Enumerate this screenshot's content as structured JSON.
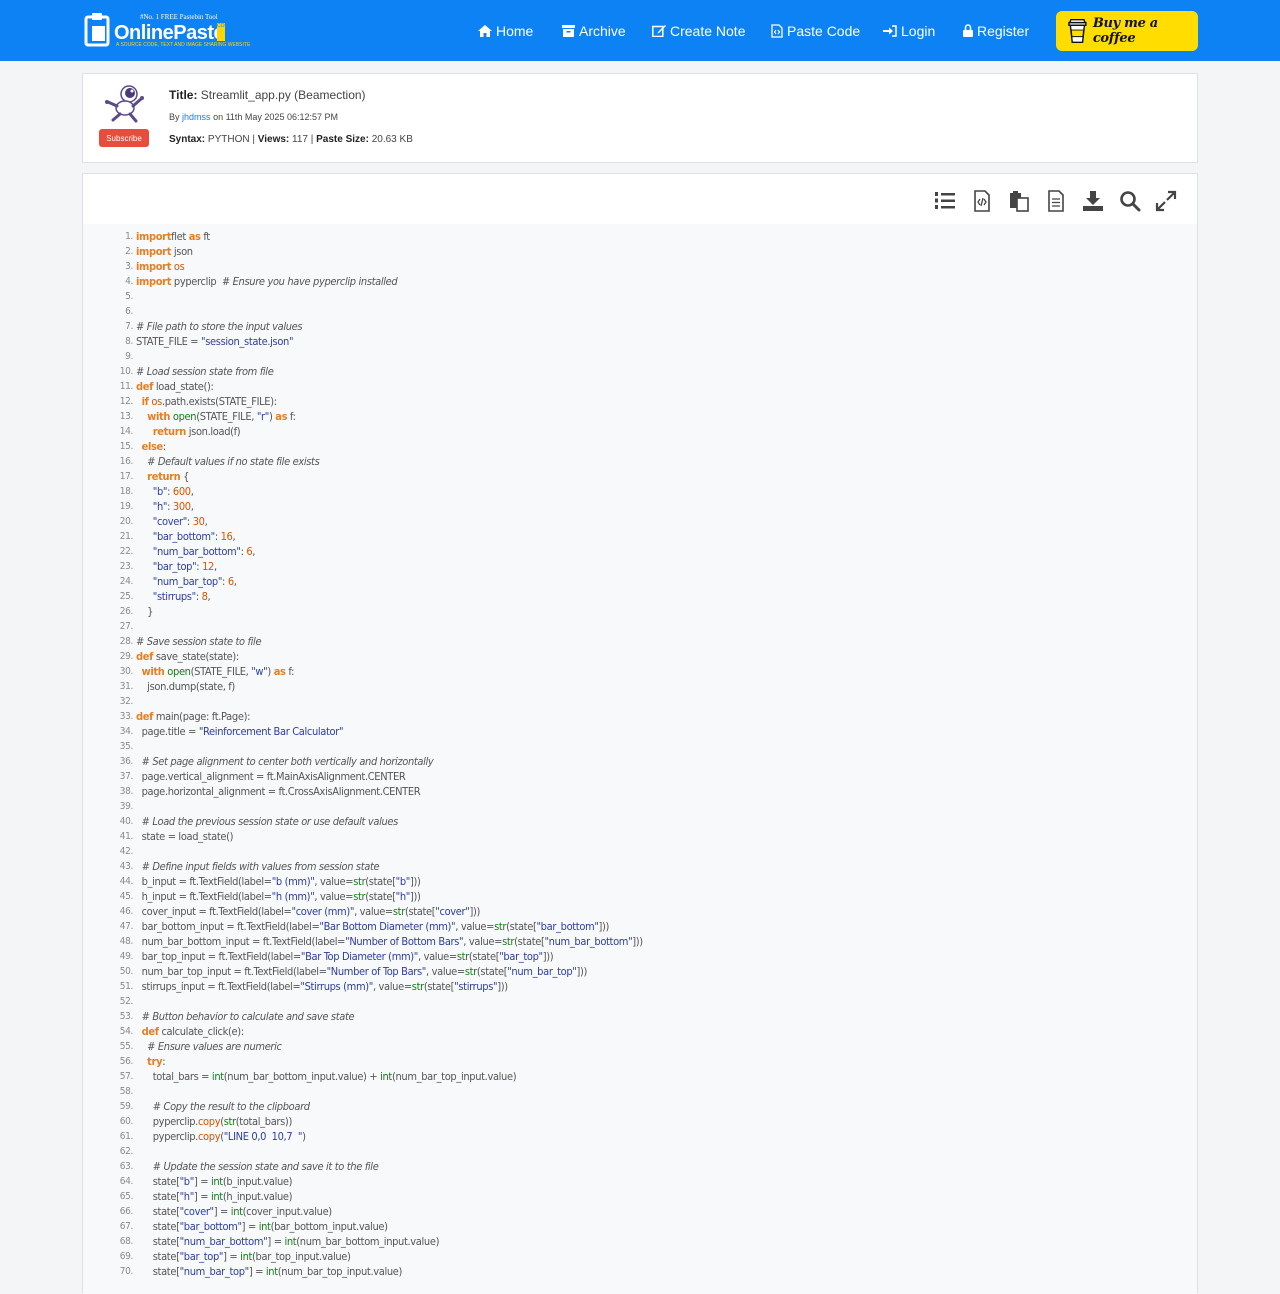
{
  "brand": {
    "tagline": "#No. 1 FREE Pastebin Tool",
    "name": "OnlinePaste",
    "com": "COM",
    "subtitle": "A SOURCE CODE, TEXT AND IMAGE SHARING WEBSITE"
  },
  "nav": {
    "home": "Home",
    "archive": "Archive",
    "create_note": "Create Note",
    "paste_code": "Paste Code",
    "login": "Login",
    "register": "Register",
    "coffee": "Buy me a coffee"
  },
  "colors": {
    "navbar": "#0d82f5",
    "coffee": "#ffdd00",
    "subscribe": "#e74c3c",
    "keyword": "#e67e22",
    "string": "#2c3e9e"
  },
  "paste": {
    "subscribe": "Subscribe",
    "title_label": "Title:",
    "title": "Streamlit_app.py (Beamection)",
    "by_label": "By",
    "author": "jhdmss",
    "date": "on 11th May 2025 06:12:57 PM",
    "syntax_label": "Syntax:",
    "syntax": "PYTHON",
    "views_label": "Views:",
    "views": "117",
    "size_label": "Paste Size:",
    "size": "20.63 KB"
  },
  "toolbar": [
    "line-numbers-icon",
    "view-source-icon",
    "copy-icon",
    "raw-icon",
    "download-icon",
    "search-icon",
    "fullscreen-icon"
  ],
  "code": [
    [
      [
        "kw",
        "import"
      ],
      [
        "",
        "flet "
      ],
      [
        "kw",
        "as"
      ],
      [
        "",
        " ft"
      ]
    ],
    [
      [
        "kw",
        "import"
      ],
      [
        "",
        " json"
      ]
    ],
    [
      [
        "kw",
        "import"
      ],
      [
        "nu",
        " os"
      ]
    ],
    [
      [
        "kw",
        "import"
      ],
      [
        "",
        " pyperclip  "
      ],
      [
        "cm",
        "# Ensure you have pyperclip installed"
      ]
    ],
    [],
    [],
    [
      [
        "cm",
        "# File path to store the input values"
      ]
    ],
    [
      [
        "",
        "STATE_FILE = "
      ],
      [
        "st",
        "\"session_state.json\""
      ]
    ],
    [],
    [
      [
        "cm",
        "# Load session state from file"
      ]
    ],
    [
      [
        "kw",
        "def"
      ],
      [
        "",
        " load_state():"
      ]
    ],
    [
      [
        "",
        "  "
      ],
      [
        "kw",
        "if"
      ],
      [
        "nu",
        " os"
      ],
      [
        "",
        ".path.exists(STATE_FILE):"
      ]
    ],
    [
      [
        "",
        "    "
      ],
      [
        "kw",
        "with"
      ],
      [
        "bi",
        " open"
      ],
      [
        "",
        "(STATE_FILE, "
      ],
      [
        "st",
        "\"r\""
      ],
      [
        "",
        ") "
      ],
      [
        "kw",
        "as"
      ],
      [
        "",
        " f:"
      ]
    ],
    [
      [
        "",
        "      "
      ],
      [
        "kw",
        "return"
      ],
      [
        "",
        " json.load(f)"
      ]
    ],
    [
      [
        "",
        "  "
      ],
      [
        "kw",
        "else"
      ],
      [
        "",
        ":"
      ]
    ],
    [
      [
        "",
        "    "
      ],
      [
        "cm",
        "# Default values if no state file exists"
      ]
    ],
    [
      [
        "",
        "    "
      ],
      [
        "kw",
        "return"
      ],
      [
        "",
        " {"
      ]
    ],
    [
      [
        "",
        "      "
      ],
      [
        "st",
        "\"b\""
      ],
      [
        "",
        ": "
      ],
      [
        "nu",
        "600"
      ],
      [
        "",
        ","
      ]
    ],
    [
      [
        "",
        "      "
      ],
      [
        "st",
        "\"h\""
      ],
      [
        "",
        ": "
      ],
      [
        "nu",
        "300"
      ],
      [
        "",
        ","
      ]
    ],
    [
      [
        "",
        "      "
      ],
      [
        "st",
        "\"cover\""
      ],
      [
        "",
        ": "
      ],
      [
        "nu",
        "30"
      ],
      [
        "",
        ","
      ]
    ],
    [
      [
        "",
        "      "
      ],
      [
        "st",
        "\"bar_bottom\""
      ],
      [
        "",
        ": "
      ],
      [
        "nu",
        "16"
      ],
      [
        "",
        ","
      ]
    ],
    [
      [
        "",
        "      "
      ],
      [
        "st",
        "\"num_bar_bottom\""
      ],
      [
        "",
        ": "
      ],
      [
        "nu",
        "6"
      ],
      [
        "",
        ","
      ]
    ],
    [
      [
        "",
        "      "
      ],
      [
        "st",
        "\"bar_top\""
      ],
      [
        "",
        ": "
      ],
      [
        "nu",
        "12"
      ],
      [
        "",
        ","
      ]
    ],
    [
      [
        "",
        "      "
      ],
      [
        "st",
        "\"num_bar_top\""
      ],
      [
        "",
        ": "
      ],
      [
        "nu",
        "6"
      ],
      [
        "",
        ","
      ]
    ],
    [
      [
        "",
        "      "
      ],
      [
        "st",
        "\"stirrups\""
      ],
      [
        "",
        ": "
      ],
      [
        "nu",
        "8"
      ],
      [
        "",
        ","
      ]
    ],
    [
      [
        "",
        "    }"
      ]
    ],
    [],
    [
      [
        "cm",
        "# Save session state to file"
      ]
    ],
    [
      [
        "kw",
        "def"
      ],
      [
        "",
        " save_state(state):"
      ]
    ],
    [
      [
        "",
        "  "
      ],
      [
        "kw",
        "with"
      ],
      [
        "bi",
        " open"
      ],
      [
        "",
        "(STATE_FILE, "
      ],
      [
        "st",
        "\"w\""
      ],
      [
        "",
        ") "
      ],
      [
        "kw",
        "as"
      ],
      [
        "",
        " f:"
      ]
    ],
    [
      [
        "",
        "    json.dump(state, f)"
      ]
    ],
    [],
    [
      [
        "kw",
        "def"
      ],
      [
        "",
        " main(page: ft.Page):"
      ]
    ],
    [
      [
        "",
        "  page.title = "
      ],
      [
        "st",
        "\"Reinforcement Bar Calculator\""
      ]
    ],
    [],
    [
      [
        "",
        "  "
      ],
      [
        "cm",
        "# Set page alignment to center both vertically and horizontally"
      ]
    ],
    [
      [
        "",
        "  page.vertical_alignment = ft.MainAxisAlignment.CENTER"
      ]
    ],
    [
      [
        "",
        "  page.horizontal_alignment = ft.CrossAxisAlignment.CENTER"
      ]
    ],
    [],
    [
      [
        "",
        "  "
      ],
      [
        "cm",
        "# Load the previous session state or use default values"
      ]
    ],
    [
      [
        "",
        "  state = load_state()"
      ]
    ],
    [],
    [
      [
        "",
        "  "
      ],
      [
        "cm",
        "# Define input fields with values from session state"
      ]
    ],
    [
      [
        "",
        "  b_input = ft.TextField(label="
      ],
      [
        "st",
        "\"b (mm)\""
      ],
      [
        "",
        ", value="
      ],
      [
        "bi",
        "str"
      ],
      [
        "",
        "(state["
      ],
      [
        "st",
        "\"b\""
      ],
      [
        "",
        "]))"
      ]
    ],
    [
      [
        "",
        "  h_input = ft.TextField(label="
      ],
      [
        "st",
        "\"h (mm)\""
      ],
      [
        "",
        ", value="
      ],
      [
        "bi",
        "str"
      ],
      [
        "",
        "(state["
      ],
      [
        "st",
        "\"h\""
      ],
      [
        "",
        "]))"
      ]
    ],
    [
      [
        "",
        "  cover_input = ft.TextField(label="
      ],
      [
        "st",
        "\"cover (mm)\""
      ],
      [
        "",
        ", value="
      ],
      [
        "bi",
        "str"
      ],
      [
        "",
        "(state["
      ],
      [
        "st",
        "\"cover\""
      ],
      [
        "",
        "]))"
      ]
    ],
    [
      [
        "",
        "  bar_bottom_input = ft.TextField(label="
      ],
      [
        "st",
        "\"Bar Bottom Diameter (mm)\""
      ],
      [
        "",
        ", value="
      ],
      [
        "bi",
        "str"
      ],
      [
        "",
        "(state["
      ],
      [
        "st",
        "\"bar_bottom\""
      ],
      [
        "",
        "]))"
      ]
    ],
    [
      [
        "",
        "  num_bar_bottom_input = ft.TextField(label="
      ],
      [
        "st",
        "\"Number of Bottom Bars\""
      ],
      [
        "",
        ", value="
      ],
      [
        "bi",
        "str"
      ],
      [
        "",
        "(state["
      ],
      [
        "st",
        "\"num_bar_bottom\""
      ],
      [
        "",
        "]))"
      ]
    ],
    [
      [
        "",
        "  bar_top_input = ft.TextField(label="
      ],
      [
        "st",
        "\"Bar Top Diameter (mm)\""
      ],
      [
        "",
        ", value="
      ],
      [
        "bi",
        "str"
      ],
      [
        "",
        "(state["
      ],
      [
        "st",
        "\"bar_top\""
      ],
      [
        "",
        "]))"
      ]
    ],
    [
      [
        "",
        "  num_bar_top_input = ft.TextField(label="
      ],
      [
        "st",
        "\"Number of Top Bars\""
      ],
      [
        "",
        ", value="
      ],
      [
        "bi",
        "str"
      ],
      [
        "",
        "(state["
      ],
      [
        "st",
        "\"num_bar_top\""
      ],
      [
        "",
        "]))"
      ]
    ],
    [
      [
        "",
        "  stirrups_input = ft.TextField(label="
      ],
      [
        "st",
        "\"Stirrups (mm)\""
      ],
      [
        "",
        ", value="
      ],
      [
        "bi",
        "str"
      ],
      [
        "",
        "(state["
      ],
      [
        "st",
        "\"stirrups\""
      ],
      [
        "",
        "]))"
      ]
    ],
    [],
    [
      [
        "",
        "  "
      ],
      [
        "cm",
        "# Button behavior to calculate and save state"
      ]
    ],
    [
      [
        "",
        "  "
      ],
      [
        "kw",
        "def"
      ],
      [
        "",
        " calculate_click(e):"
      ]
    ],
    [
      [
        "",
        "    "
      ],
      [
        "cm",
        "# Ensure values are numeric"
      ]
    ],
    [
      [
        "",
        "    "
      ],
      [
        "kw",
        "try"
      ],
      [
        "",
        ":"
      ]
    ],
    [
      [
        "",
        "      total_bars = "
      ],
      [
        "bi",
        "int"
      ],
      [
        "",
        "(num_bar_bottom_input.value) + "
      ],
      [
        "bi",
        "int"
      ],
      [
        "",
        "(num_bar_top_input.value)"
      ]
    ],
    [],
    [
      [
        "",
        "      "
      ],
      [
        "cm",
        "# Copy the result to the clipboard"
      ]
    ],
    [
      [
        "",
        "      pyperclip."
      ],
      [
        "nu",
        "copy"
      ],
      [
        "",
        "("
      ],
      [
        "bi",
        "str"
      ],
      [
        "",
        "(total_bars))"
      ]
    ],
    [
      [
        "",
        "      pyperclip."
      ],
      [
        "nu",
        "copy"
      ],
      [
        "",
        "("
      ],
      [
        "st",
        "\"LINE 0,0  10,7  \""
      ],
      [
        "",
        ")"
      ]
    ],
    [],
    [
      [
        "",
        "      "
      ],
      [
        "cm",
        "# Update the session state and save it to the file"
      ]
    ],
    [
      [
        "",
        "      state["
      ],
      [
        "st",
        "\"b\""
      ],
      [
        "",
        "] = "
      ],
      [
        "bi",
        "int"
      ],
      [
        "",
        "(b_input.value)"
      ]
    ],
    [
      [
        "",
        "      state["
      ],
      [
        "st",
        "\"h\""
      ],
      [
        "",
        "] = "
      ],
      [
        "bi",
        "int"
      ],
      [
        "",
        "(h_input.value)"
      ]
    ],
    [
      [
        "",
        "      state["
      ],
      [
        "st",
        "\"cover\""
      ],
      [
        "",
        "] = "
      ],
      [
        "bi",
        "int"
      ],
      [
        "",
        "(cover_input.value)"
      ]
    ],
    [
      [
        "",
        "      state["
      ],
      [
        "st",
        "\"bar_bottom\""
      ],
      [
        "",
        "] = "
      ],
      [
        "bi",
        "int"
      ],
      [
        "",
        "(bar_bottom_input.value)"
      ]
    ],
    [
      [
        "",
        "      state["
      ],
      [
        "st",
        "\"num_bar_bottom\""
      ],
      [
        "",
        "] = "
      ],
      [
        "bi",
        "int"
      ],
      [
        "",
        "(num_bar_bottom_input.value)"
      ]
    ],
    [
      [
        "",
        "      state["
      ],
      [
        "st",
        "\"bar_top\""
      ],
      [
        "",
        "] = "
      ],
      [
        "bi",
        "int"
      ],
      [
        "",
        "(bar_top_input.value)"
      ]
    ],
    [
      [
        "",
        "      state["
      ],
      [
        "st",
        "\"num_bar_top\""
      ],
      [
        "",
        "] = "
      ],
      [
        "bi",
        "int"
      ],
      [
        "",
        "(num_bar_top_input.value)"
      ]
    ]
  ]
}
